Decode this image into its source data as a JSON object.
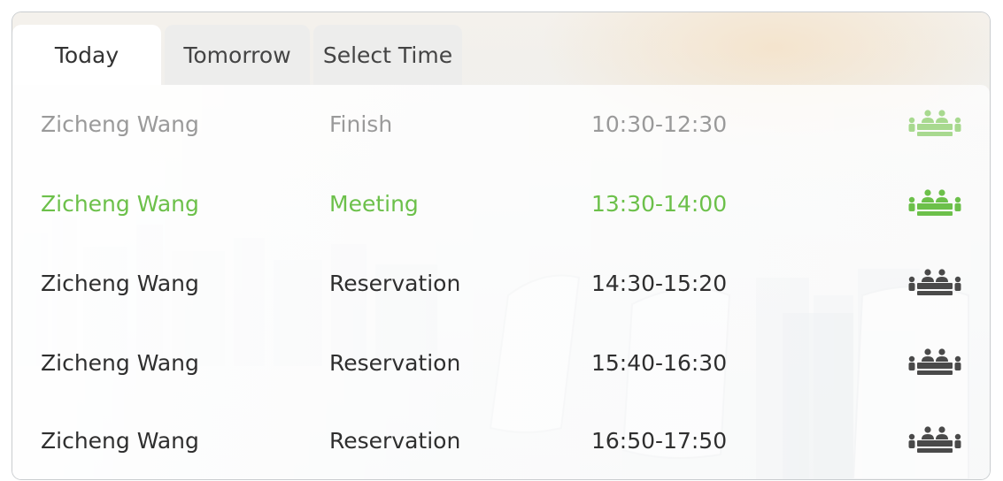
{
  "tabs": [
    {
      "label": "Today",
      "active": true
    },
    {
      "label": "Tomorrow",
      "active": false
    },
    {
      "label": "Select Time",
      "active": false
    }
  ],
  "schedule": [
    {
      "name": "Zicheng Wang",
      "status": "Finish",
      "time": "10:30-12:30",
      "state": "finished",
      "icon": "meeting-room-icon",
      "icon_color": "#a8d98f"
    },
    {
      "name": "Zicheng Wang",
      "status": "Meeting",
      "time": "13:30-14:00",
      "state": "active",
      "icon": "meeting-room-icon",
      "icon_color": "#6cc04a"
    },
    {
      "name": "Zicheng Wang",
      "status": "Reservation",
      "time": "14:30-15:20",
      "state": "reserved",
      "icon": "meeting-room-icon",
      "icon_color": "#4a4a4a"
    },
    {
      "name": "Zicheng Wang",
      "status": "Reservation",
      "time": "15:40-16:30",
      "state": "reserved",
      "icon": "meeting-room-icon",
      "icon_color": "#4a4a4a"
    },
    {
      "name": "Zicheng Wang",
      "status": "Reservation",
      "time": "16:50-17:50",
      "state": "reserved",
      "icon": "meeting-room-icon",
      "icon_color": "#4a4a4a"
    }
  ],
  "colors": {
    "accent": "#6cc04a",
    "finished_text": "#9a9a9a",
    "text": "#2f2f2f"
  }
}
